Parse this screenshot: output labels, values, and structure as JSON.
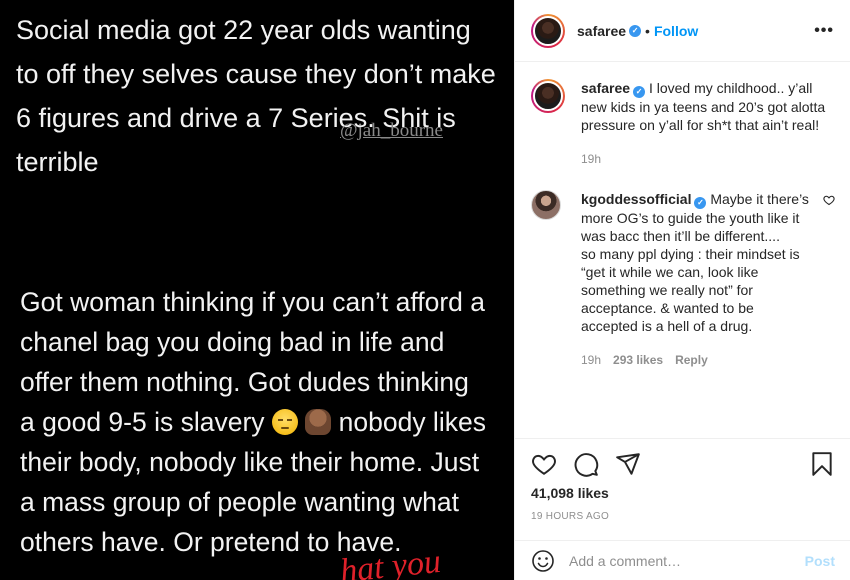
{
  "image": {
    "top_text": "Social media got 22 year olds wanting\nto off they selves cause they don’t make\n6 figures and drive a 7 Series. Shit is\nterrible",
    "watermark": "@jah_bourne",
    "bottom_text_before_emoji": "Got woman thinking if you can’t afford a\nchanel bag you doing bad in life and\noffer them nothing. Got dudes thinking\na good 9-5 is slavery ",
    "bottom_text_after_emoji": " nobody likes\ntheir body, nobody like their home. Just\na mass group of people wanting what\nothers have. Or pretend to have.",
    "red_text": "hat you"
  },
  "header": {
    "username": "safaree",
    "verified_glyph": "✓",
    "dot": "•",
    "follow_label": "Follow",
    "more_glyph": "•••"
  },
  "caption": {
    "username": "safaree",
    "text": "I loved my childhood.. y’all new kids in ya teens and 20’s got alotta pressure on y’all for sh*t that ain’t real!",
    "time": "19h"
  },
  "comment1": {
    "username": "kgoddessofficial",
    "text": "Maybe it there’s more OG’s to guide the youth like it was bacc then it’ll be different....\nso many ppl dying : their mindset is “get it while we can, look like something we really not” for acceptance. & wanted to be accepted is a hell of a drug.",
    "time": "19h",
    "likes": "293 likes",
    "reply_label": "Reply"
  },
  "post": {
    "likes": "41,098 likes",
    "timestamp": "19 HOURS AGO"
  },
  "add_comment": {
    "placeholder": "Add a comment…",
    "post_label": "Post"
  },
  "icons": {
    "like": "heart-icon",
    "comment": "comment-icon",
    "share": "share-icon",
    "save": "bookmark-icon",
    "emoji": "smiley-icon"
  },
  "colors": {
    "accent": "#0095f6",
    "verified": "#3897f0",
    "muted": "#8e8e8e",
    "post_disabled": "#b2dffc",
    "image_bg": "#000000",
    "red_scrawl": "#e0212a"
  }
}
